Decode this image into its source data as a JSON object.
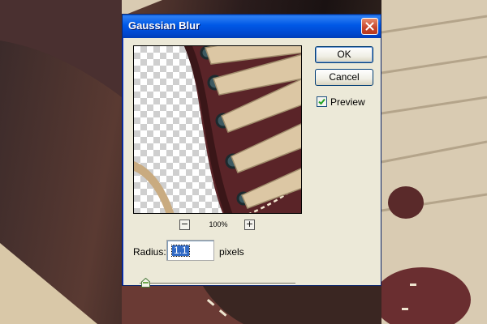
{
  "dialog": {
    "title": "Gaussian Blur",
    "ok_label": "OK",
    "cancel_label": "Cancel",
    "preview_label": "Preview",
    "preview_checked": true,
    "zoom_minus": "−",
    "zoom_plus": "+",
    "zoom_level": "100%",
    "radius_label": "Radius:",
    "radius_value": "1.1",
    "radius_unit": "pixels",
    "icons": {
      "close": "close-icon",
      "check": "checkmark-icon",
      "slider": "slider-thumb-icon"
    }
  },
  "colors": {
    "titlebar": "#0058E6",
    "dialog_bg": "#ECE9D8",
    "close_button": "#C6442A",
    "selection": "#316AC5"
  }
}
